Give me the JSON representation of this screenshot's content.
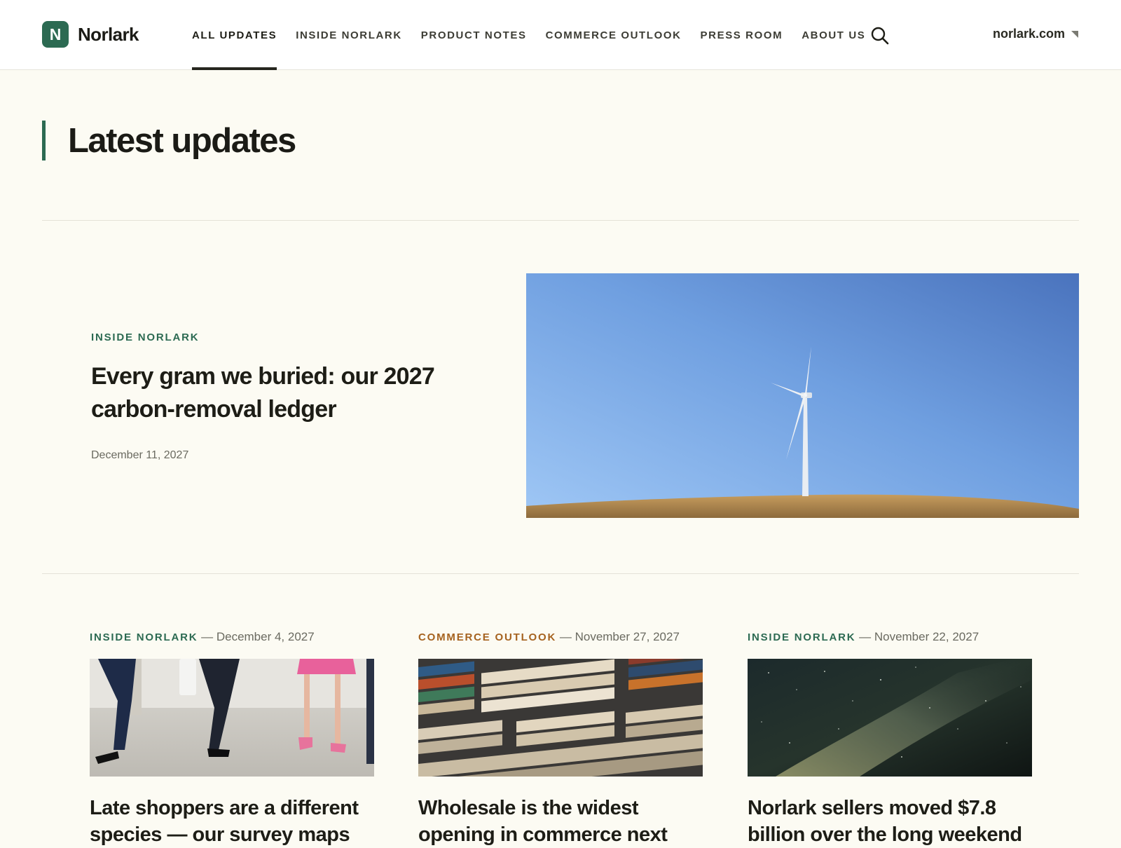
{
  "brand": {
    "logo_letter": "N",
    "name": "Norlark",
    "accent": "#2c6a52"
  },
  "nav": {
    "items": [
      {
        "label": "ALL UPDATES",
        "active": true
      },
      {
        "label": "INSIDE NORLARK",
        "active": false
      },
      {
        "label": "PRODUCT NOTES",
        "active": false
      },
      {
        "label": "COMMERCE OUTLOOK",
        "active": false
      },
      {
        "label": "PRESS ROOM",
        "active": false
      },
      {
        "label": "ABOUT US",
        "active": false
      }
    ],
    "search_icon": "search-icon",
    "site_link": "norlark.com",
    "site_link_icon": "external-arrow-icon"
  },
  "page": {
    "title": "Latest updates"
  },
  "featured": {
    "category": "INSIDE NORLARK",
    "category_color": "#2c6a52",
    "title": "Every gram we buried: our 2027 carbon-removal ledger",
    "date": "December 11, 2027",
    "image": "wind-turbine-photo"
  },
  "cards": [
    {
      "category": "INSIDE NORLARK",
      "category_color": "#2c6a52",
      "date": "— December 4, 2027",
      "image": "shoppers-walking-photo",
      "title": "Late shoppers are a different species — our survey maps"
    },
    {
      "category": "COMMERCE OUTLOOK",
      "category_color": "#a5621f",
      "date": "— November 27, 2027",
      "image": "shipping-containers-photo",
      "title": "Wholesale is the widest opening in commerce next"
    },
    {
      "category": "INSIDE NORLARK",
      "category_color": "#2c6a52",
      "date": "— November 22, 2027",
      "image": "night-sky-photo",
      "title": "Norlark sellers moved $7.8 billion over the long weekend"
    }
  ]
}
